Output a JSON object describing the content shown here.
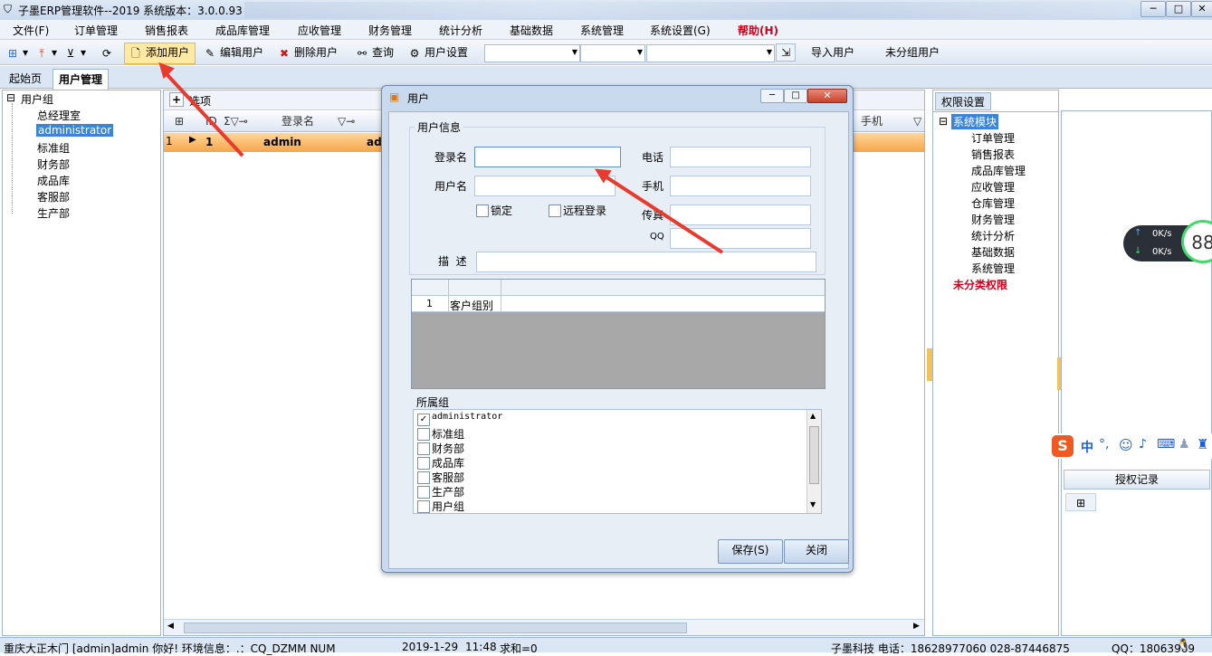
{
  "window": {
    "title": "子墨ERP管理软件--2019 系统版本：3.0.0.93"
  },
  "menu": [
    "文件(F)",
    "订单管理",
    "销售报表",
    "成品库管理",
    "应收管理",
    "财务管理",
    "统计分析",
    "基础数据",
    "系统管理",
    "系统设置(G)",
    "帮助(H)"
  ],
  "toolbar": {
    "add_user": "添加用户",
    "edit_user": "编辑用户",
    "delete_user": "删除用户",
    "query": "查询",
    "user_settings": "用户设置",
    "import_users": "导入用户",
    "ungrouped_users": "未分组用户"
  },
  "tabs": [
    "起始页",
    "用户管理"
  ],
  "left_tree": {
    "root": "用户组",
    "children": [
      "总经理室",
      "administrator",
      "标准组",
      "财务部",
      "成品库",
      "客服部",
      "生产部"
    ],
    "selected": "administrator"
  },
  "grid": {
    "options_label": "选项",
    "columns": [
      "ID",
      "登录名",
      "手机"
    ],
    "rows": [
      {
        "index": "1",
        "id": "1",
        "login": "admin",
        "extra": "ad"
      }
    ]
  },
  "right_panel": {
    "tab": "权限设置",
    "root": "系统模块",
    "modules": [
      "订单管理",
      "销售报表",
      "成品库管理",
      "应收管理",
      "仓库管理",
      "财务管理",
      "统计分析",
      "基础数据",
      "系统管理"
    ],
    "uncategorized": "未分类权限",
    "auth_record": "授权记录"
  },
  "speed_widget": {
    "up": "0K/s",
    "down": "0K/s",
    "value": "88"
  },
  "dialog": {
    "title": "用户",
    "group_user_info": "用户信息",
    "login_label": "登录名",
    "login_value": "",
    "username_label": "用户名",
    "phone_label": "电话",
    "mobile_label": "手机",
    "fax_label": "传真",
    "qq_label": "QQ",
    "lock_label": "锁定",
    "remote_label": "远程登录",
    "desc_label": "描  述",
    "subgrid_row_index": "1",
    "subgrid_row_value": "客户组别",
    "group_belongs": "所属组",
    "groups": [
      {
        "name": "administrator",
        "checked": true
      },
      {
        "name": "标准组",
        "checked": false
      },
      {
        "name": "财务部",
        "checked": false
      },
      {
        "name": "成品库",
        "checked": false
      },
      {
        "name": "客服部",
        "checked": false
      },
      {
        "name": "生产部",
        "checked": false
      },
      {
        "name": "用户组",
        "checked": false
      }
    ],
    "save": "保存(S)",
    "close": "关闭"
  },
  "statusbar": {
    "left": "重庆大正木门  [admin]admin 你好! 环境信息：.：CQ_DZMM  NUM",
    "date": "2019-1-29",
    "time": "11:48",
    "sum": "求和=0",
    "company": "子墨科技 电话：18628977060 028-87446875",
    "qq": "QQ：18063969"
  },
  "colors": {
    "accent": "#3c84d8",
    "highlight_row": "#f7a54a",
    "arrow": "#e83a2d",
    "menu_help": "#d0021b"
  }
}
